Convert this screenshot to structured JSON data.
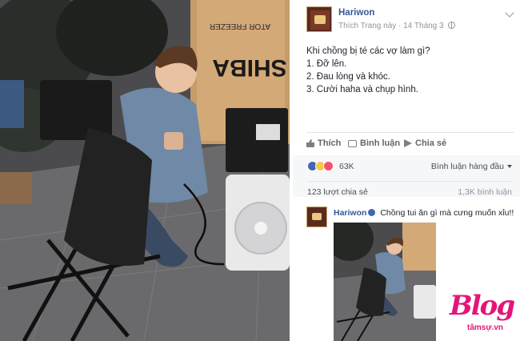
{
  "post": {
    "author": "Hariwon",
    "page_action": "Thích Trang này",
    "separator": "·",
    "date": "14 Tháng 3",
    "lines": [
      "Khi chồng bị té các vợ làm gì?",
      "1. Đỡ lên.",
      "2. Đau lòng và khóc.",
      "3. Cười haha và chụp hình."
    ]
  },
  "actions": {
    "like": "Thích",
    "comment": "Bình luận",
    "share": "Chia sẻ"
  },
  "stats": {
    "reactions": "63K",
    "sort": "Bình luận hàng đầu",
    "shares": "123 lượt chia sẻ",
    "comments": "1,3K bình luận"
  },
  "comment": {
    "author": "Hariwon",
    "text": "Chồng tui ăn gì mà cưng muốn xỉu!!"
  },
  "photo_text": {
    "box_top": "ATOR FREEZER",
    "box_brand": "SHIBA"
  },
  "watermark": {
    "logo": "Blog",
    "sub": "tâmsự.vn"
  },
  "colors": {
    "link": "#365899",
    "accent": "#4267b2",
    "watermark": "#e4157a"
  }
}
